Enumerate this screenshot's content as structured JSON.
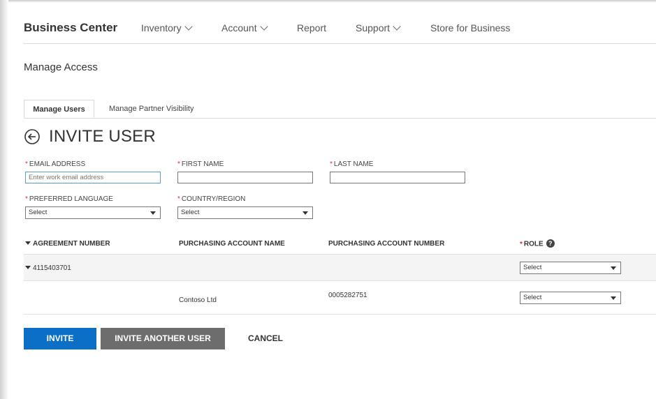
{
  "nav": {
    "brand": "Business Center",
    "items": [
      {
        "label": "Inventory",
        "has_dropdown": true
      },
      {
        "label": "Account",
        "has_dropdown": true
      },
      {
        "label": "Report",
        "has_dropdown": false
      },
      {
        "label": "Support",
        "has_dropdown": true
      },
      {
        "label": "Store for Business",
        "has_dropdown": false
      }
    ]
  },
  "page": {
    "title": "Manage Access"
  },
  "tabs": [
    {
      "label": "Manage Users",
      "active": true
    },
    {
      "label": "Manage Partner Visibility",
      "active": false
    }
  ],
  "heading": {
    "text": "INVITE USER",
    "back_icon": "back-arrow-circle-icon"
  },
  "form": {
    "required_mark": "*",
    "email": {
      "label": "EMAIL ADDRESS",
      "placeholder": "Enter work email address",
      "value": ""
    },
    "first_name": {
      "label": "FIRST NAME",
      "value": ""
    },
    "last_name": {
      "label": "LAST NAME",
      "value": ""
    },
    "language": {
      "label": "PREFERRED LANGUAGE",
      "value": "Select"
    },
    "country": {
      "label": "COUNTRY/REGION",
      "value": "Select"
    }
  },
  "table": {
    "headers": {
      "agreement": "AGREEMENT NUMBER",
      "account_name": "PURCHASING ACCOUNT NAME",
      "account_number": "PURCHASING ACCOUNT NUMBER",
      "role": "ROLE"
    },
    "help_icon": "?",
    "group_row": {
      "agreement": "4115403701",
      "role": "Select"
    },
    "detail_row": {
      "account_name": "Contoso Ltd",
      "account_number": "0005282751",
      "role": "Select"
    }
  },
  "buttons": {
    "invite": "INVITE",
    "invite_another": "INVITE ANOTHER USER",
    "cancel": "CANCEL"
  },
  "colors": {
    "primary": "#0b6fc7",
    "secondary": "#6d6d6d",
    "required": "#d13438",
    "focus": "#5b9bd5"
  }
}
